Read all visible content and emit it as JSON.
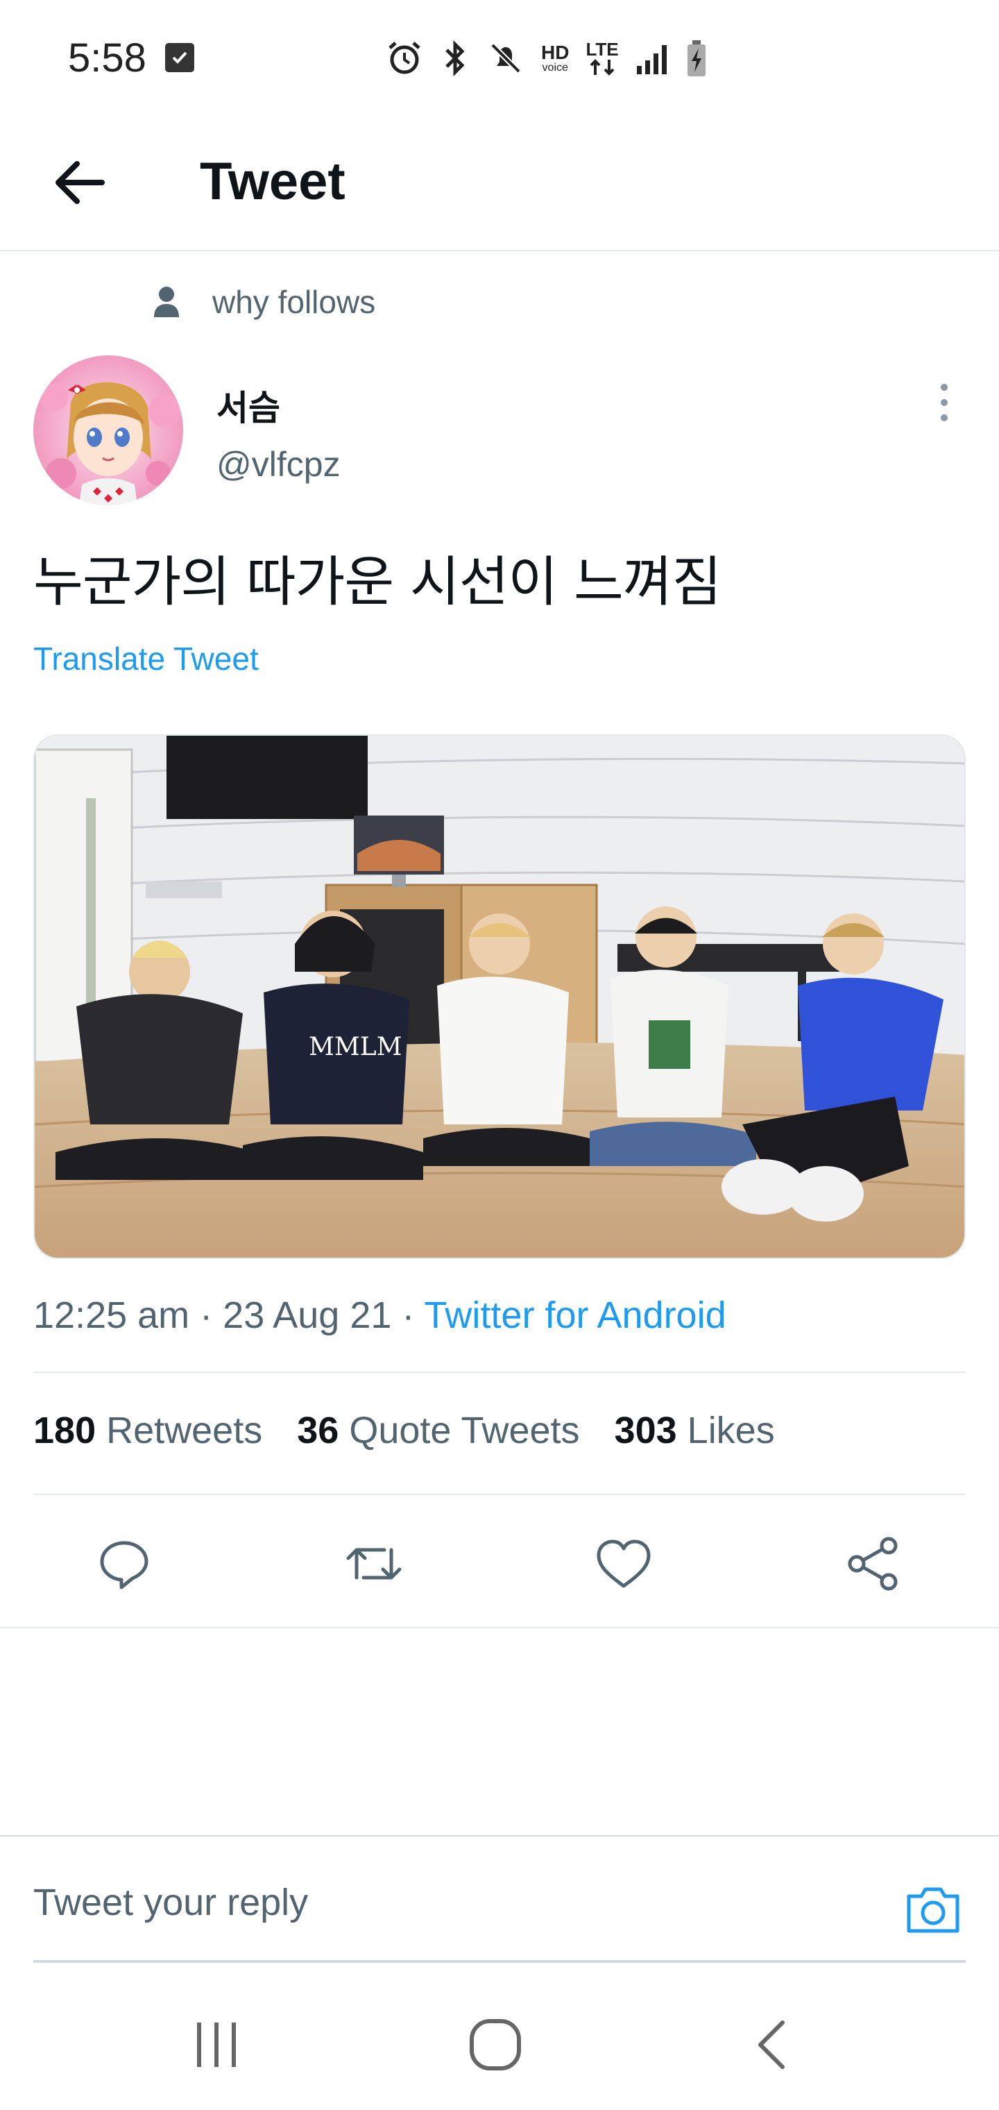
{
  "status_bar": {
    "time": "5:58",
    "net_hd": "HD",
    "net_voice": "voice",
    "net_lte": "LTE"
  },
  "header": {
    "title": "Tweet",
    "back_icon": "arrow-left-icon"
  },
  "tweet": {
    "social_context": "why follows",
    "author_name": "서슴",
    "author_handle": "@vlfcpz",
    "text": "누군가의 따가운 시선이 느껴짐",
    "translate_label": "Translate Tweet",
    "time": "12:25 am",
    "date": "23 Aug 21",
    "source": "Twitter for Android",
    "separator": " · "
  },
  "stats": {
    "retweets_count": "180",
    "retweets_label": "Retweets",
    "quotes_count": "36",
    "quotes_label": "Quote Tweets",
    "likes_count": "303",
    "likes_label": "Likes"
  },
  "actions": [
    "reply-icon",
    "retweet-icon",
    "like-icon",
    "share-icon"
  ],
  "reply": {
    "placeholder": "Tweet your reply"
  },
  "colors": {
    "accent": "#1d9bf0",
    "text_primary": "#0f1419",
    "text_secondary": "#536471",
    "divider": "#e6e9eb"
  }
}
